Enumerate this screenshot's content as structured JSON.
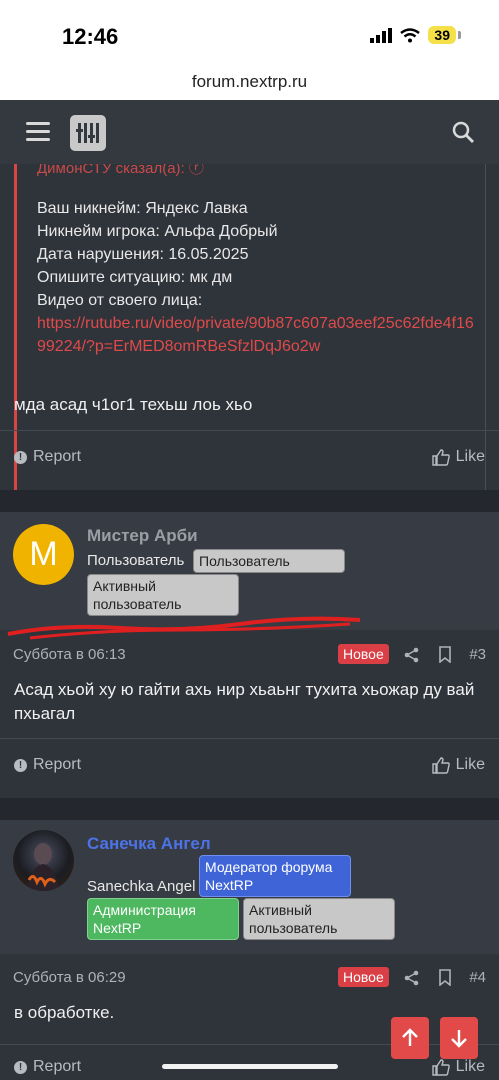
{
  "status_bar": {
    "time": "12:46",
    "battery": "39"
  },
  "browser": {
    "url": "forum.nextrp.ru"
  },
  "quote": {
    "header": "ДимонСТУ сказал(а): ⓡ",
    "lines": [
      "Ваш никнейм: Яндекс Лавка",
      "Никнейм игрока: Альфа Добрый",
      "Дата нарушения: 16.05.2025",
      "Опишите ситуацию: мк дм",
      "Видео от своего лица:"
    ],
    "link": "https://rutube.ru/video/private/90b87c607a03eef25c62fde4f1699224/?p=ErMED8omRBeSfzlDqJ6o2w"
  },
  "posts": [
    {
      "text": "мда асад ч1ог1 техьш лоь хьо",
      "report_label": "Report",
      "like_label": "Like"
    },
    {
      "author": "Мистер Арби",
      "avatar_letter": "M",
      "user_title": "Пользователь",
      "banners": [
        "Пользователь",
        "Активный пользователь"
      ],
      "date": "Суббота в 06:13",
      "badge": "Новое",
      "number": "#3",
      "text": "Асад хьой ху ю гайти ахь нир хьаьнг тухита хьожар ду вай пхьагал",
      "report_label": "Report",
      "like_label": "Like"
    },
    {
      "author": "Санечка Ангел",
      "user_title": "Sanechka Angel",
      "banners": [
        "Модератор форума NextRP",
        "Администрация NextRP",
        "Активный пользователь"
      ],
      "date": "Суббота в 06:29",
      "badge": "Новое",
      "number": "#4",
      "text": "в обработке.",
      "report_label": "Report",
      "like_label": "Like"
    }
  ],
  "colors": {
    "accent_red": "#e24a4a",
    "moderator_blue": "#3e64d8",
    "admin_green": "#4eb860"
  }
}
